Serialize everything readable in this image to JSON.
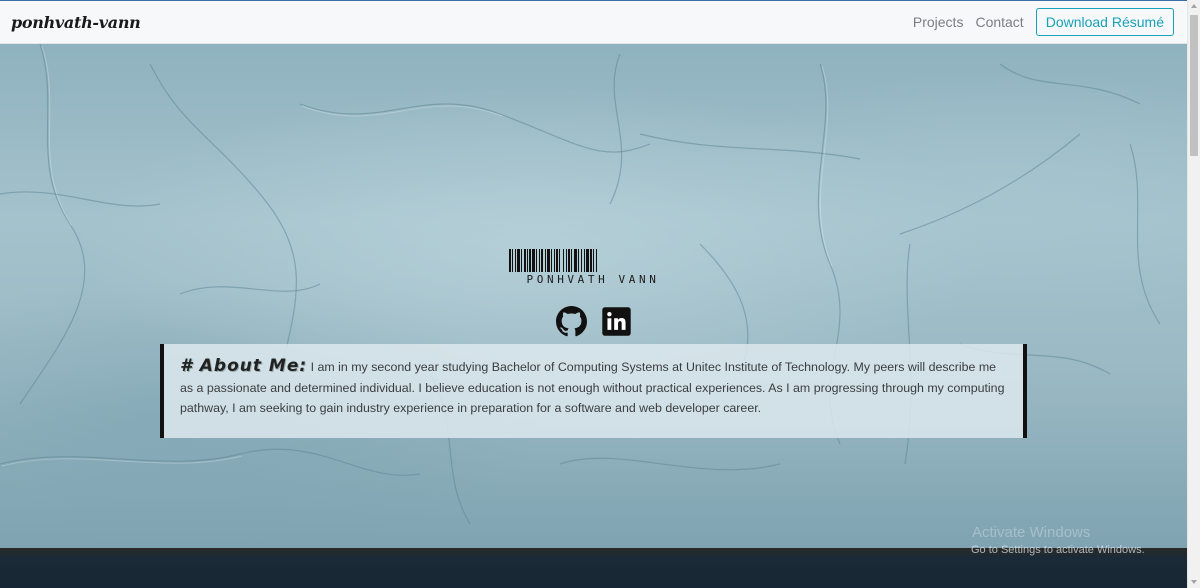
{
  "navbar": {
    "brand": "ponhvath-vann",
    "links": [
      "Projects",
      "Contact"
    ],
    "resume_button": "Download Résumé"
  },
  "hero": {
    "barcode_name": "PONHVATH VANN",
    "social": {
      "github_icon": "github-icon",
      "linkedin_icon": "linkedin-icon"
    },
    "about": {
      "heading": "# About Me:",
      "body": "I am in my second year studying Bachelor of Computing Systems at Unitec Institute of Technology. My peers will describe me as a passionate and determined individual. I believe education is not enough without practical experiences. As I am progressing through my computing pathway, I am seeking to gain industry experience in preparation for a software and web developer career."
    }
  },
  "watermark": {
    "title": "Activate Windows",
    "subtitle": "Go to Settings to activate Windows."
  },
  "colors": {
    "accent": "#17a2b8",
    "nav_bg": "#f7f8fa",
    "card_border": "#111111"
  }
}
